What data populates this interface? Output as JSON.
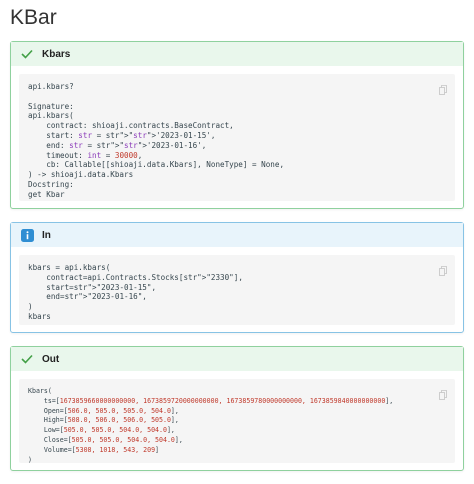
{
  "page": {
    "title": "KBar"
  },
  "blocks": [
    {
      "title": "Kbars",
      "kind": "success",
      "icon": "check-icon",
      "lines": [
        "api.kbars?",
        "",
        "Signature:",
        "api.kbars(",
        "    contract: shioaji.contracts.BaseContract,",
        "    start: str = '2023-01-15',",
        "    end: str = '2023-01-16',",
        "    timeout: int = 30000,",
        "    cb: Callable[[shioaji.data.Kbars], NoneType] = None,",
        ") -> shioaji.data.Kbars",
        "Docstring:",
        "get Kbar"
      ]
    },
    {
      "title": "In",
      "kind": "info",
      "icon": "info-icon",
      "lines": [
        "kbars = api.kbars(",
        "    contract=api.Contracts.Stocks[\"2330\"],",
        "    start=\"2023-01-15\",",
        "    end=\"2023-01-16\",",
        ")",
        "kbars"
      ]
    },
    {
      "title": "Out",
      "kind": "success",
      "icon": "check-icon",
      "lines": [
        "Kbars(",
        "    ts=[1673859660000000000, 1673859720000000000, 1673859780000000000, 1673859840000000000],",
        "    Open=[506.0, 505.0, 505.0, 504.0],",
        "    High=[508.0, 506.0, 506.0, 505.0],",
        "    Low=[505.0, 505.0, 504.0, 504.0],",
        "    Close=[505.0, 505.0, 504.0, 504.0],",
        "    Volume=[5308, 1018, 543, 209]",
        ")"
      ]
    }
  ],
  "colors": {
    "success_border": "#8fd19e",
    "success_head": "#e9f7ec",
    "success_icon": "#43a047",
    "info_border": "#87c3e5",
    "info_head": "#e8f4fb",
    "info_icon": "#2f8ed3"
  }
}
